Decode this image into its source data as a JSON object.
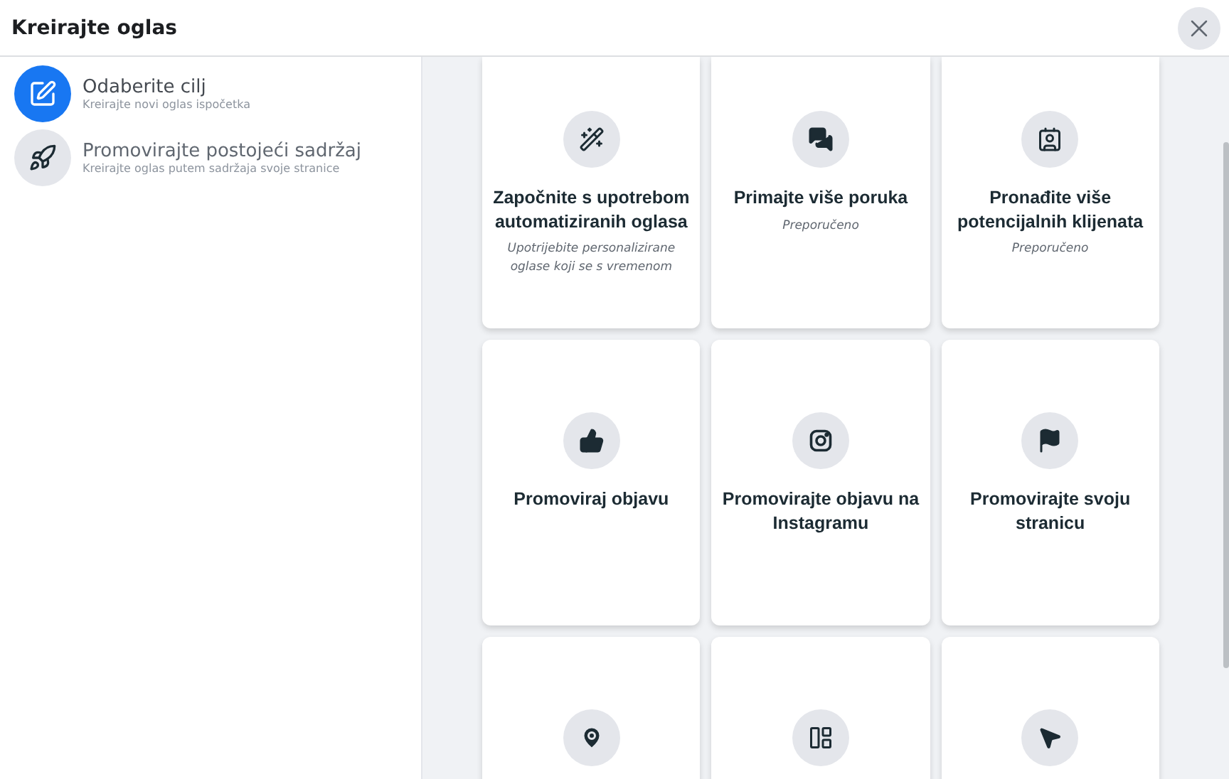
{
  "window": {
    "title": "Kreirajte oglas"
  },
  "sidebar": {
    "items": [
      {
        "title": "Odaberite cilj",
        "subtitle": "Kreirajte novi oglas ispočetka",
        "selected": true
      },
      {
        "title": "Promovirajte postojeći sadržaj",
        "subtitle": "Kreirajte oglas putem sadržaja svoje stranice",
        "selected": false
      }
    ]
  },
  "cards": [
    {
      "kind": "objective",
      "title": "Započnite s upotrebom automatiziranih oglasa",
      "subtitle": "Upotrijebite personalizirane oglase koji se s vremenom"
    },
    {
      "kind": "objective",
      "title": "Primajte više poruka",
      "subtitle": "Preporučeno"
    },
    {
      "kind": "objective",
      "title": "Pronađite više potencijalnih klijenata",
      "subtitle": "Preporučeno"
    },
    {
      "kind": "objective",
      "title": "Promoviraj objavu"
    },
    {
      "kind": "objective",
      "title": "Promovirajte objavu na Instagramu"
    },
    {
      "kind": "objective",
      "title": "Promovirajte svoju stranicu"
    },
    {
      "kind": "cut_off"
    },
    {
      "kind": "cut_off"
    },
    {
      "kind": "cut_off"
    }
  ]
}
